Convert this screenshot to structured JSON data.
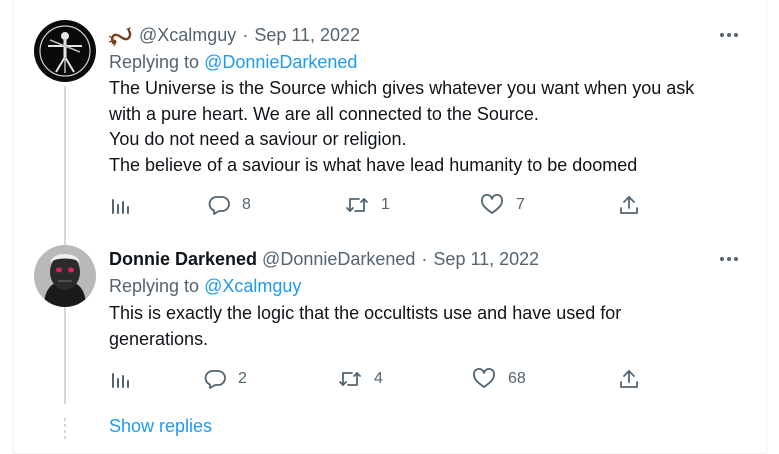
{
  "tweet1": {
    "handle": "@Xcalmguy",
    "date": "Sep 11, 2022",
    "replying_label": "Replying to",
    "replying_to": "@DonnieDarkened",
    "lines": [
      "The Universe is the Source which gives whatever you want when you ask",
      "with a pure heart. We are all connected to the Source.",
      "You do not need a saviour or religion.",
      "The believe of a saviour is what have lead humanity to be doomed"
    ],
    "replies": "8",
    "retweets": "1",
    "likes": "7",
    "emoji_icon": "scorpion-icon"
  },
  "tweet2": {
    "display_name": "Donnie Darkened",
    "handle": "@DonnieDarkened",
    "date": "Sep 11, 2022",
    "replying_label": "Replying to",
    "replying_to": "@Xcalmguy",
    "lines": [
      "This is exactly the logic that the occultists use and have used for",
      "generations."
    ],
    "replies": "2",
    "retweets": "4",
    "likes": "68"
  },
  "show_replies": "Show replies",
  "colors": {
    "text": "#0f1419",
    "muted": "#536471",
    "link": "#1d9bf0",
    "line": "#cfd9de"
  }
}
